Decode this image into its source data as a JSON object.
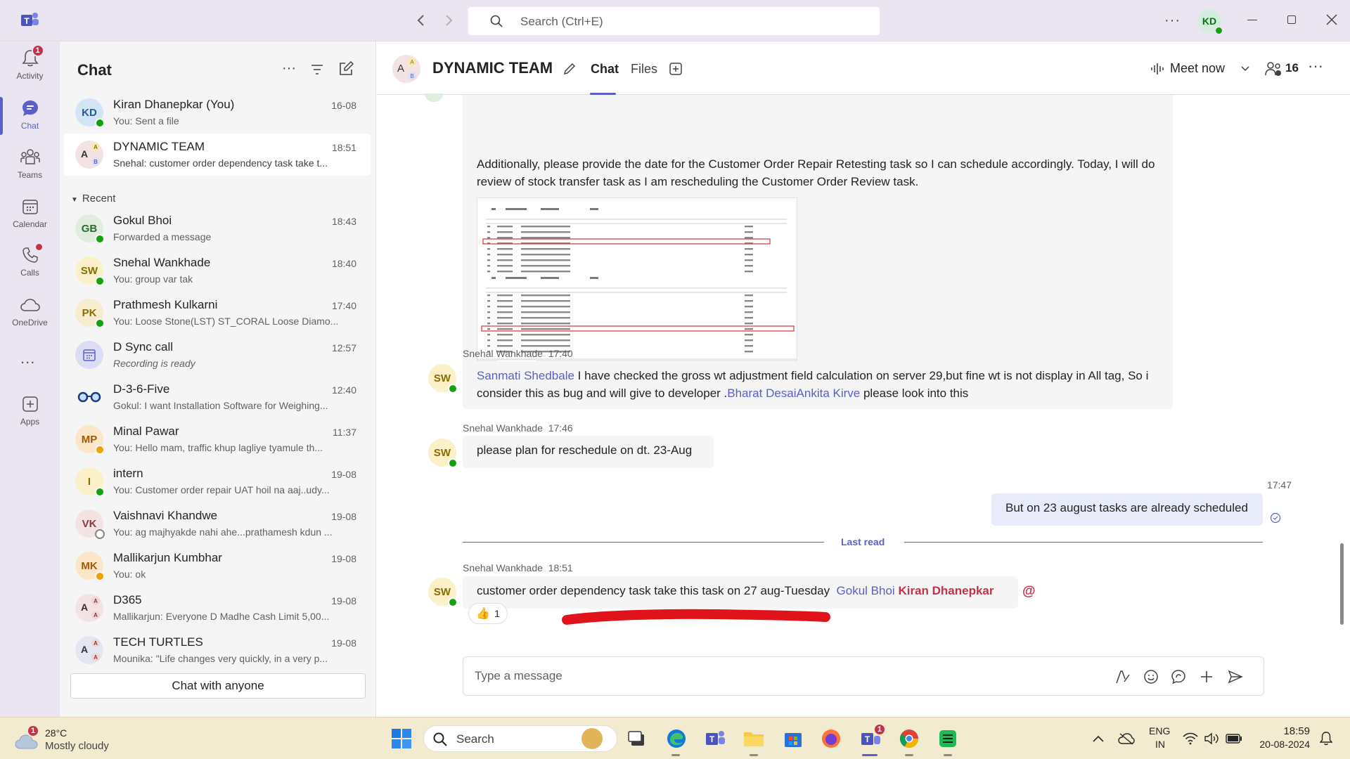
{
  "titlebar": {
    "search_placeholder": "Search (Ctrl+E)",
    "user_initials": "KD"
  },
  "rail": {
    "items": [
      {
        "label": "Activity",
        "badge": "1"
      },
      {
        "label": "Chat"
      },
      {
        "label": "Teams"
      },
      {
        "label": "Calendar"
      },
      {
        "label": "Calls"
      },
      {
        "label": "OneDrive"
      },
      {
        "label": "Apps"
      }
    ],
    "more": "..."
  },
  "chatlist": {
    "title": "Chat",
    "recent_label": "Recent",
    "chat_with_anyone": "Chat with anyone",
    "pinned": [
      {
        "initials": "KD",
        "name": "Kiran Dhanepkar (You)",
        "preview": "You: Sent a file",
        "time": "16-08"
      },
      {
        "initials": "A",
        "name": "DYNAMIC TEAM",
        "preview": "Snehal: customer order dependency task take t...",
        "time": "18:51"
      }
    ],
    "recent": [
      {
        "initials": "GB",
        "name": "Gokul Bhoi",
        "preview": "Forwarded a message",
        "time": "18:43"
      },
      {
        "initials": "SW",
        "name": "Snehal Wankhade",
        "preview": "You: group var tak",
        "time": "18:40"
      },
      {
        "initials": "PK",
        "name": "Prathmesh Kulkarni",
        "preview": "You: Loose Stone(LST) ST_CORAL Loose Diamo...",
        "time": "17:40"
      },
      {
        "initials": "",
        "name": "D Sync call",
        "preview": "Recording is ready",
        "time": "12:57"
      },
      {
        "initials": "",
        "name": "D-3-6-Five",
        "preview": "Gokul: I want Installation Software for Weighing...",
        "time": "12:40"
      },
      {
        "initials": "MP",
        "name": "Minal Pawar",
        "preview": "You: Hello mam, traffic khup lagliye tyamule th...",
        "time": "11:37"
      },
      {
        "initials": "I",
        "name": "intern",
        "preview": "You: Customer order repair UAT hoil na aaj..udy...",
        "time": "19-08"
      },
      {
        "initials": "VK",
        "name": "Vaishnavi Khandwe",
        "preview": "You: ag majhyakde nahi ahe...prathamesh kdun ...",
        "time": "19-08"
      },
      {
        "initials": "MK",
        "name": "Mallikarjun Kumbhar",
        "preview": "You: ok",
        "time": "19-08"
      },
      {
        "initials": "A",
        "name": "D365",
        "preview": "Mallikarjun: Everyone D Madhe Cash Limit  5,00...",
        "time": "19-08"
      },
      {
        "initials": "A",
        "name": "TECH TURTLES",
        "preview": "Mounika: \"Life changes very quickly, in a very p...",
        "time": "19-08"
      }
    ]
  },
  "header": {
    "team_name": "DYNAMIC TEAM",
    "tab_chat": "Chat",
    "tab_files": "Files",
    "meet_now": "Meet now",
    "participants": "16"
  },
  "messages": {
    "m1_text": "Additionally, please provide the date for the Customer Order Repair Retesting task so I can schedule accordingly. Today, I will do review of  stock transfer task as I am rescheduling the Customer Order Review task.",
    "m2_sender": "Snehal Wankhade",
    "m2_time": "17:40",
    "m2_mention1": "Sanmati Shedbale",
    "m2_text1": "  I have checked the gross wt adjustment field calculation on server 29,but fine wt is not display in All tag, So i consider this as bug and will give to developer .",
    "m2_mention2": "Bharat Desai",
    "m2_mention3": "Ankita Kirve",
    "m2_text2": " please look into this",
    "m3_sender": "Snehal Wankhade",
    "m3_time": "17:46",
    "m3_text": "please plan for reschedule on dt. 23-Aug",
    "m4_time": "17:47",
    "m4_text": "But on 23 august tasks are already scheduled",
    "last_read": "Last read",
    "m5_sender": "Snehal Wankhade",
    "m5_time": "18:51",
    "m5_text": "customer order dependency task take this task on 27 aug-Tuesday  ",
    "m5_mention1": "Gokul Bhoi",
    "m5_mention2": "Kiran Dhanepkar",
    "m5_at": "@",
    "m5_reaction_count": "1",
    "sender_initials": "SW"
  },
  "composer": {
    "placeholder": "Type a message"
  },
  "taskbar": {
    "weather_temp": "28°C",
    "weather_desc": "Mostly cloudy",
    "weather_badge": "1",
    "search_label": "Search",
    "teams_badge": "1",
    "lang_top": "ENG",
    "lang_bottom": "IN",
    "clock_time": "18:59",
    "clock_date": "20-08-2024"
  },
  "colors": {
    "accent": "#5b5fc7",
    "presence_available": "#13a10e",
    "presence_away": "#eaa300",
    "alert": "#c4314b"
  }
}
